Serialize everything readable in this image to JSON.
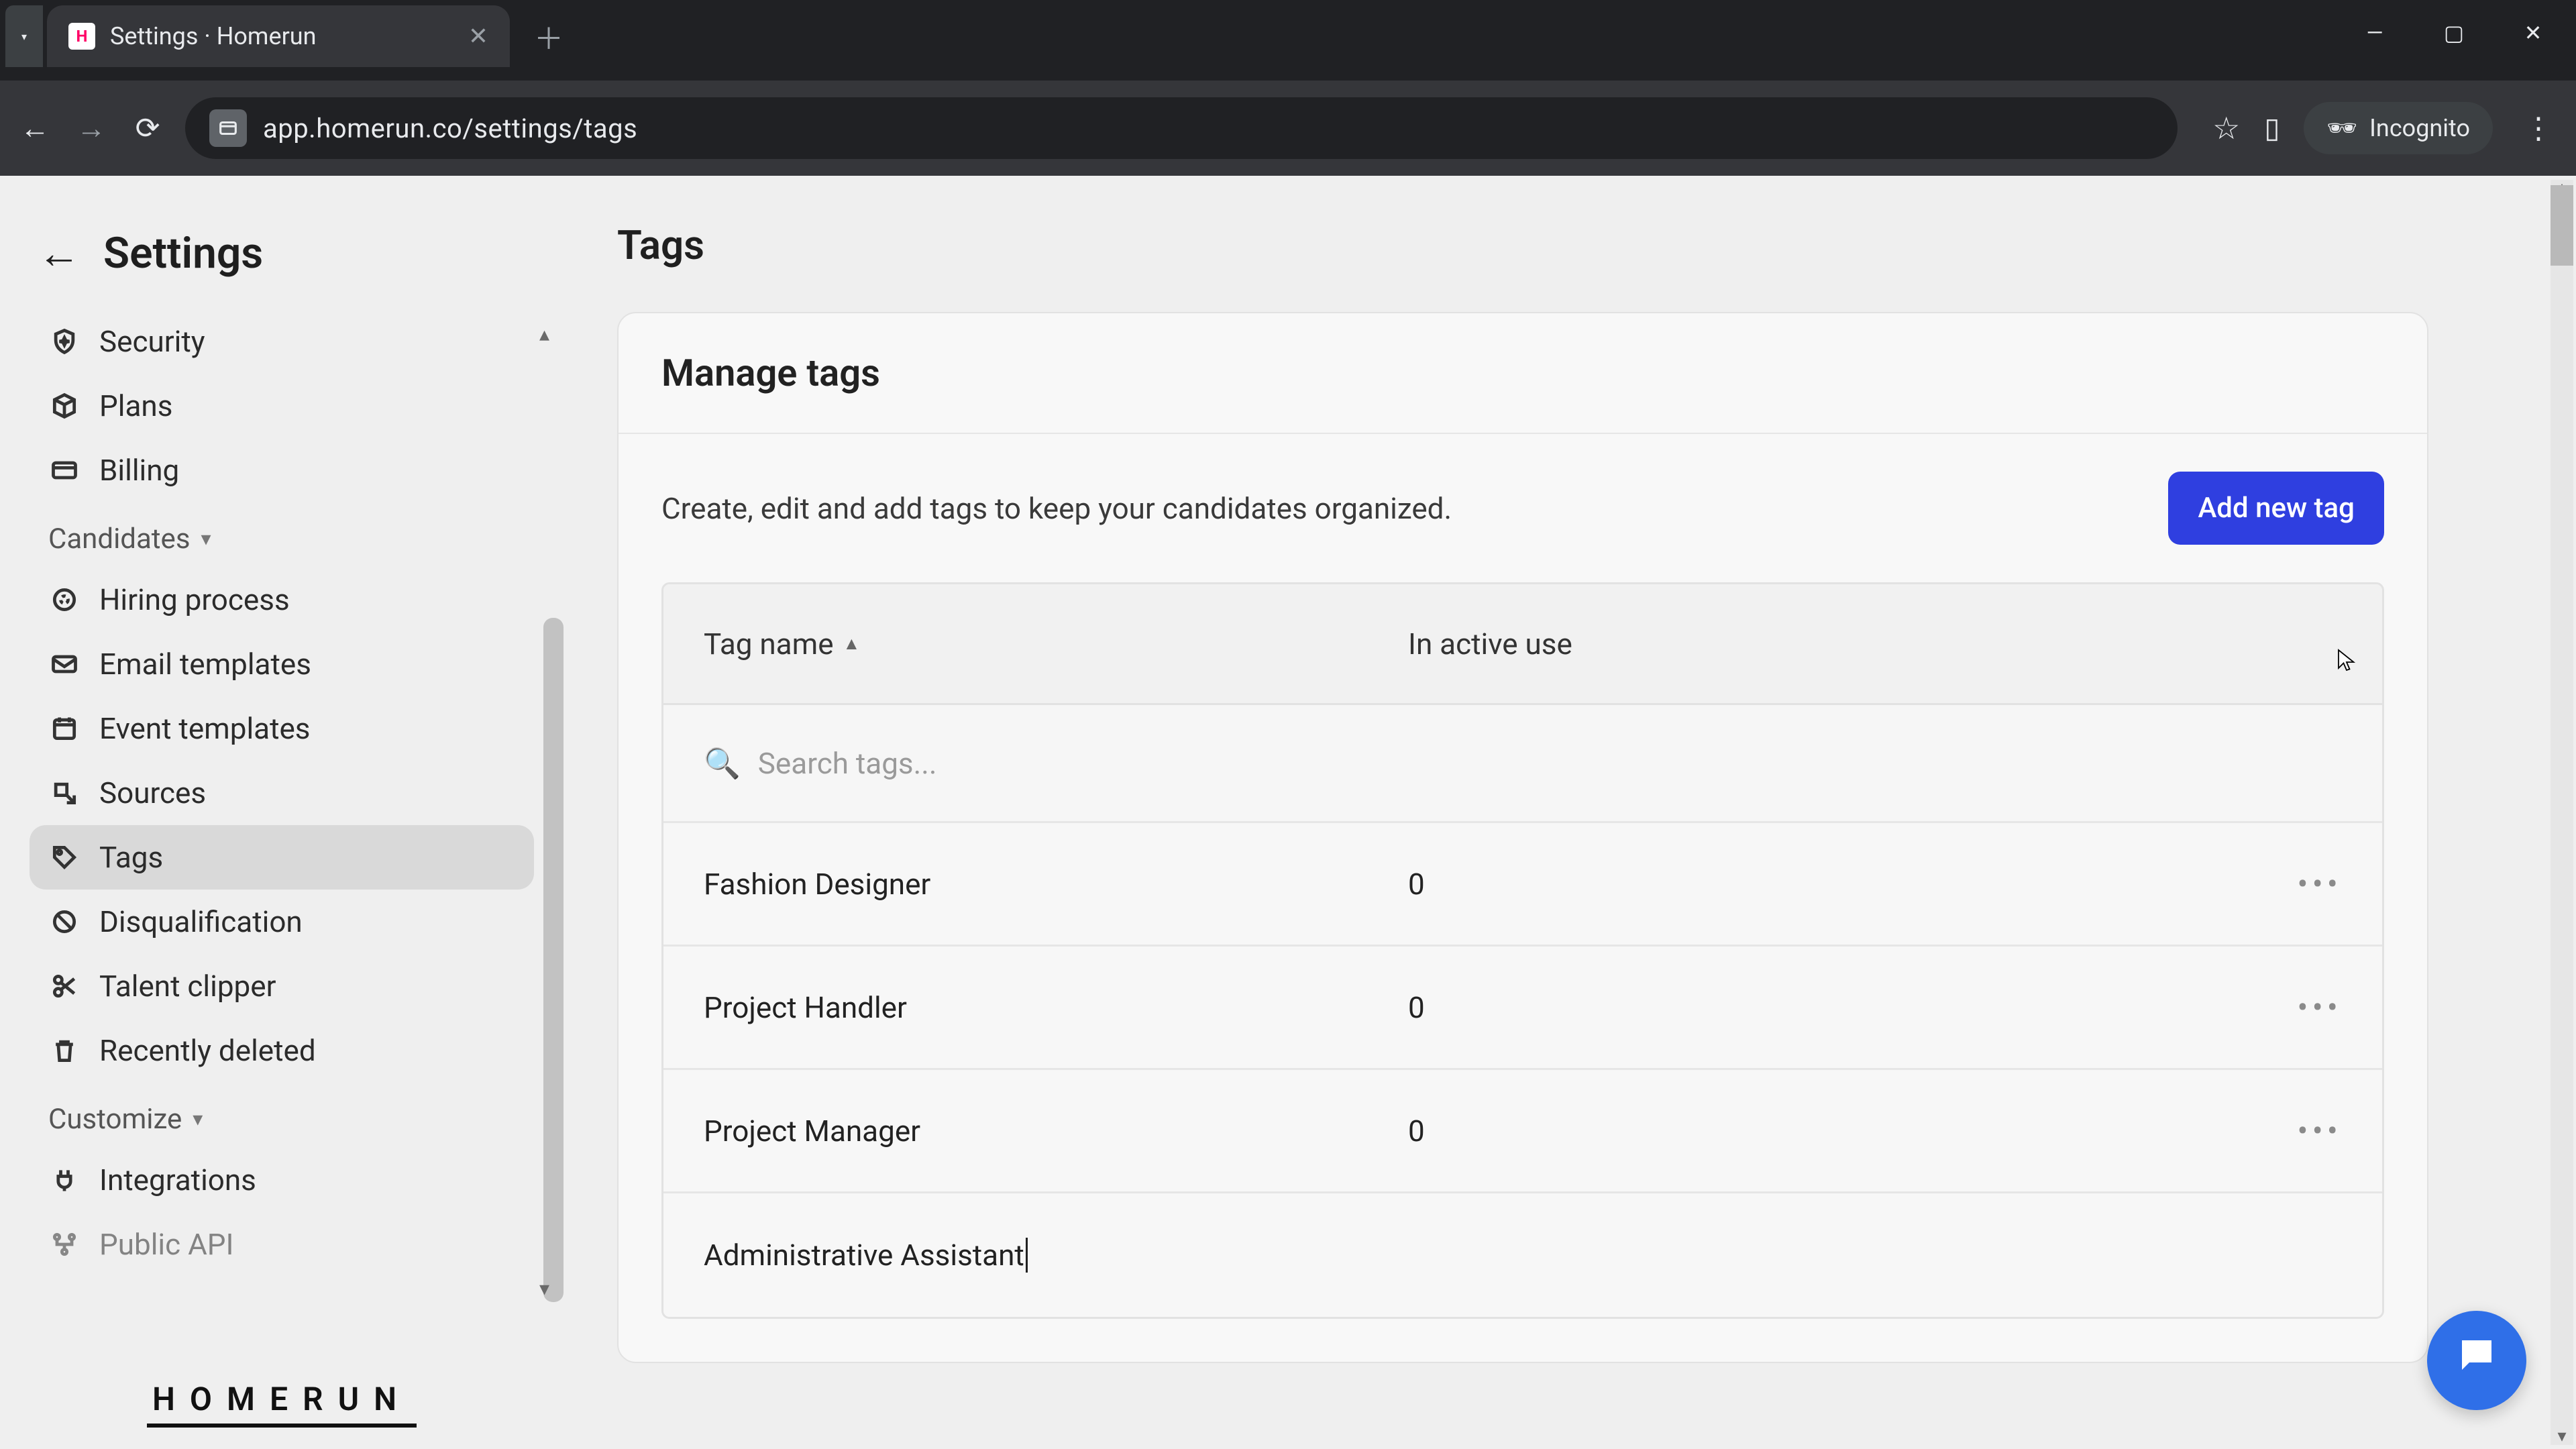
{
  "browser": {
    "tab_title": "Settings · Homerun",
    "url": "app.homerun.co/settings/tags",
    "incognito_label": "Incognito"
  },
  "sidebar": {
    "back_label": "Settings",
    "items": [
      {
        "icon": "shield-star-icon",
        "label": "Security"
      },
      {
        "icon": "cube-icon",
        "label": "Plans"
      },
      {
        "icon": "card-icon",
        "label": "Billing"
      }
    ],
    "group_candidates": "Candidates",
    "candidates_items": [
      {
        "icon": "target-icon",
        "label": "Hiring process"
      },
      {
        "icon": "mail-icon",
        "label": "Email templates"
      },
      {
        "icon": "calendar-icon",
        "label": "Event templates"
      },
      {
        "icon": "import-icon",
        "label": "Sources"
      },
      {
        "icon": "tag-icon",
        "label": "Tags",
        "active": true
      },
      {
        "icon": "no-icon",
        "label": "Disqualification"
      },
      {
        "icon": "scissors-icon",
        "label": "Talent clipper"
      },
      {
        "icon": "trash-icon",
        "label": "Recently deleted"
      }
    ],
    "group_customize": "Customize",
    "customize_items": [
      {
        "icon": "plug-icon",
        "label": "Integrations"
      },
      {
        "icon": "api-icon",
        "label": "Public API"
      }
    ],
    "brand": "HOMERUN"
  },
  "page": {
    "title": "Tags",
    "card_title": "Manage tags",
    "card_desc": "Create, edit and add tags to keep your candidates organized.",
    "add_button": "Add new tag",
    "columns": {
      "name": "Tag name",
      "use": "In active use"
    },
    "search_placeholder": "Search tags...",
    "rows": [
      {
        "name": "Fashion Designer",
        "use": "0"
      },
      {
        "name": "Project Handler",
        "use": "0"
      },
      {
        "name": "Project Manager",
        "use": "0"
      }
    ],
    "editing_row": {
      "name": "Administrative Assistant"
    }
  }
}
